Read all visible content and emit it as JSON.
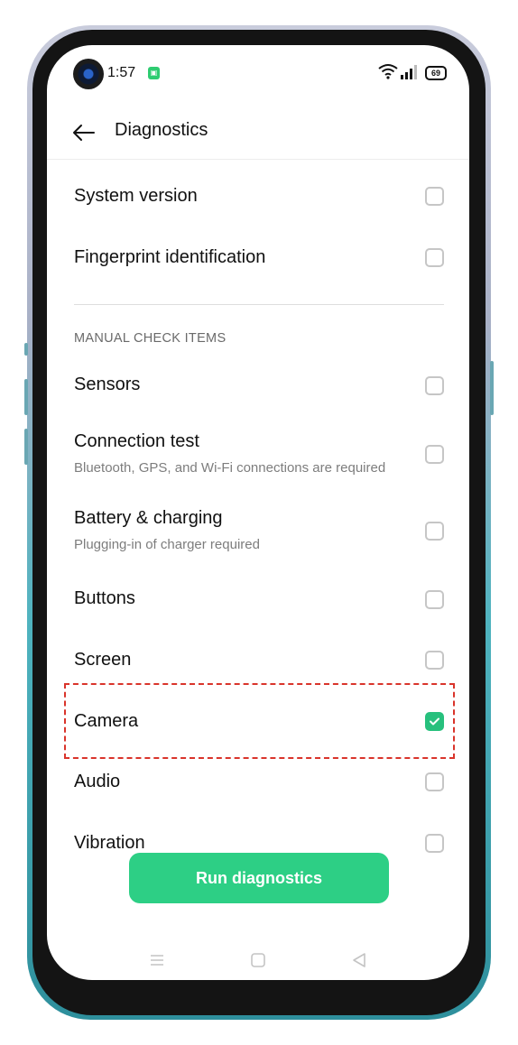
{
  "status_bar": {
    "time": "1:57",
    "notification_icon": "app-notification-icon",
    "battery_level": "69",
    "icons": [
      "wifi-icon",
      "signal-icon",
      "battery-icon"
    ]
  },
  "header": {
    "back_icon": "arrow-left-icon",
    "title": "Diagnostics"
  },
  "auto_items": [
    {
      "title": "System version",
      "checked": false
    },
    {
      "title": "Fingerprint identification",
      "checked": false
    }
  ],
  "manual_section": {
    "header": "MANUAL CHECK ITEMS",
    "items": [
      {
        "title": "Sensors",
        "subtitle": "",
        "checked": false
      },
      {
        "title": "Connection test",
        "subtitle": "Bluetooth, GPS, and Wi-Fi connections are required",
        "checked": false
      },
      {
        "title": "Battery & charging",
        "subtitle": "Plugging-in of charger required",
        "checked": false
      },
      {
        "title": "Buttons",
        "subtitle": "",
        "checked": false
      },
      {
        "title": "Screen",
        "subtitle": "",
        "checked": false
      },
      {
        "title": "Camera",
        "subtitle": "",
        "checked": true
      },
      {
        "title": "Audio",
        "subtitle": "",
        "checked": false
      },
      {
        "title": "Vibration",
        "subtitle": "",
        "checked": false
      }
    ]
  },
  "run_button": {
    "label": "Run diagnostics"
  },
  "nav_bar": {
    "icons": [
      "menu-icon",
      "home-icon",
      "back-triangle-icon"
    ]
  },
  "colors": {
    "accent": "#2dcf85",
    "checked": "#27c07d",
    "highlight_border": "#d9342b"
  }
}
